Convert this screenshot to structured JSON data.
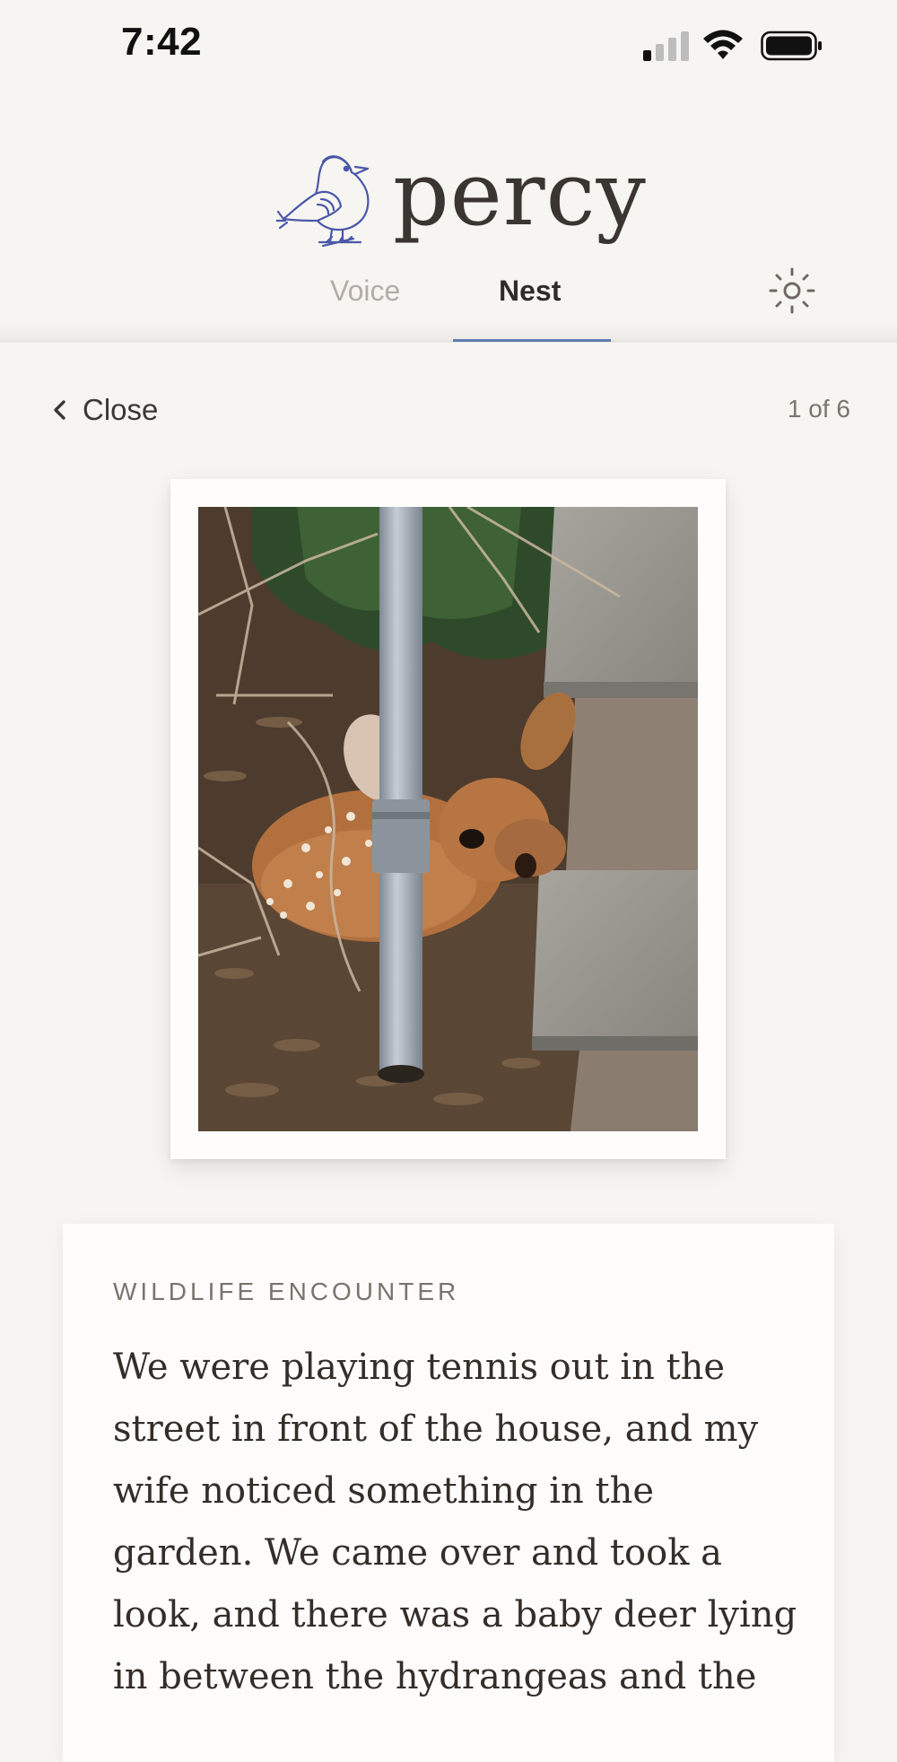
{
  "status_bar": {
    "time": "7:42",
    "icons": [
      "cellular-signal-icon",
      "wifi-icon",
      "battery-icon"
    ]
  },
  "header": {
    "app_name": "percy",
    "logo_icon": "bird-icon",
    "settings_icon": "sun-settings-icon",
    "tabs": [
      {
        "label": "Voice",
        "active": false
      },
      {
        "label": "Nest",
        "active": true
      }
    ]
  },
  "nav": {
    "close_label": "Close",
    "counter": "1 of 6"
  },
  "photo": {
    "subject": "fawn-photo"
  },
  "story": {
    "category": "WILDLIFE ENCOUNTER",
    "text": "We were playing tennis out in the street in front of the house, and my wife noticed something in the garden. We came over and took a look, and there was a baby deer lying in between the hydrangeas and the"
  },
  "colors": {
    "background": "#f7f5f1",
    "accent": "#5f7bb0",
    "logo_ink": "#4a57a8",
    "text_primary": "#2f2b28",
    "text_muted": "#b3ada7"
  }
}
